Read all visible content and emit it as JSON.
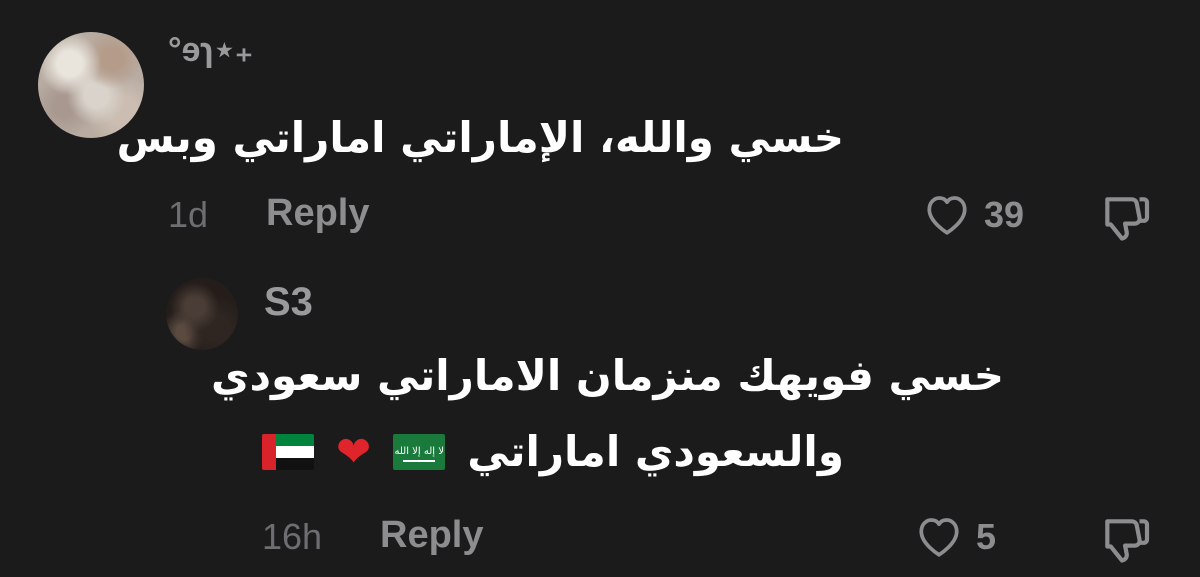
{
  "comments": [
    {
      "username": "°ɘɿ⋆₊",
      "text": "خسي والله، الإماراتي اماراتي وبس",
      "time": "1d",
      "reply_label": "Reply",
      "likes": "39",
      "icons": {
        "like": "heart-outline-icon",
        "dislike": "thumbs-down-icon"
      }
    }
  ],
  "reply": {
    "username": "S3",
    "text_line1": "خسي فويهك منزمان الاماراتي سعودي",
    "text_line2": "والسعودي اماراتي",
    "emoji": {
      "saudi_flag_text": "لا إله إلا الله",
      "heart": "❤"
    },
    "time": "16h",
    "reply_label": "Reply",
    "likes": "5",
    "icons": {
      "like": "heart-outline-icon",
      "dislike": "thumbs-down-icon"
    }
  },
  "colors": {
    "background": "#1b1b1c",
    "primary_text": "#ffffff",
    "secondary_text": "#8d8d90",
    "heart": "#e0242c"
  }
}
